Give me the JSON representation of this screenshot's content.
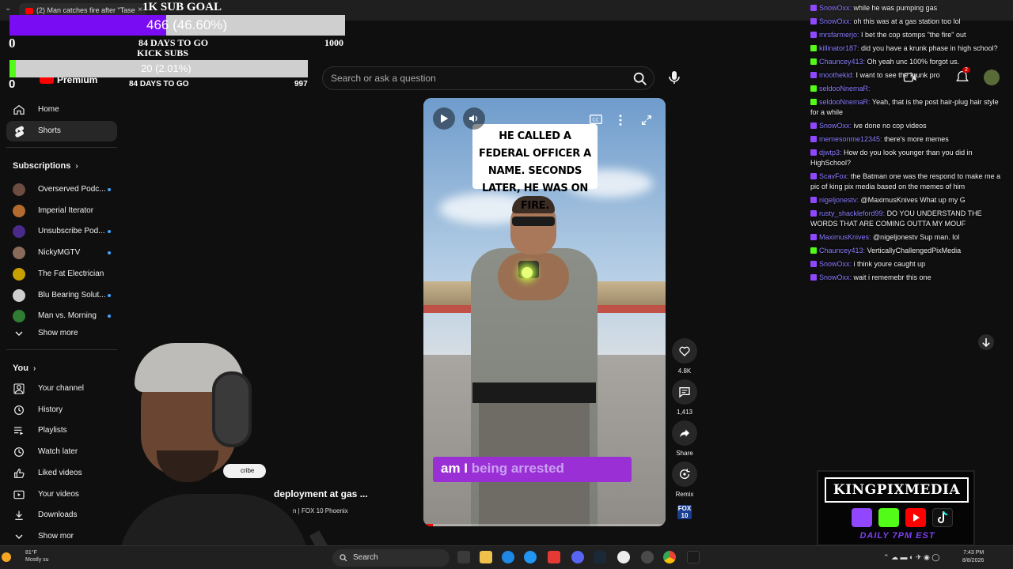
{
  "browser": {
    "tab_title": "(2) Man catches fire after \"Tase",
    "tab_close": "×"
  },
  "goal": {
    "title": "1K SUB GOAL",
    "bar_label": "466 (46.60%)",
    "progress": 0.466,
    "left_value": "0",
    "days": "84 DAYS TO GO",
    "right_value": "1000"
  },
  "kick_goal": {
    "title": "KICK SUBS",
    "bar_label": "20 (2.01%)",
    "progress": 0.0201,
    "left_value": "0",
    "days": "84 DAYS TO GO",
    "right_value": "997"
  },
  "header": {
    "logo_label": "Premium",
    "search_placeholder": "Search or ask a question",
    "notification_count": "2"
  },
  "sidebar": {
    "nav": [
      {
        "label": "Home",
        "icon": "home-icon"
      },
      {
        "label": "Shorts",
        "icon": "shorts-icon"
      }
    ],
    "subscriptions_title": "Subscriptions",
    "subscriptions": [
      {
        "label": "Overserved Podc...",
        "dot": true,
        "color": "#6d4c41"
      },
      {
        "label": "Imperial Iterator",
        "dot": false,
        "color": "#b36a2e"
      },
      {
        "label": "Unsubscribe Pod...",
        "dot": true,
        "color": "#4a2a8a"
      },
      {
        "label": "NickyMGTV",
        "dot": true,
        "color": "#8a6a5a"
      },
      {
        "label": "The Fat Electrician",
        "dot": false,
        "color": "#c8a000"
      },
      {
        "label": "Blu Bearing Solut...",
        "dot": true,
        "color": "#cfcfcf"
      },
      {
        "label": "Man vs. Morning",
        "dot": true,
        "color": "#2e7d32"
      }
    ],
    "show_more": "Show more",
    "you_title": "You",
    "you_items": [
      {
        "label": "Your channel",
        "icon": "person-icon"
      },
      {
        "label": "History",
        "icon": "history-icon"
      },
      {
        "label": "Playlists",
        "icon": "playlist-icon"
      },
      {
        "label": "Watch later",
        "icon": "clock-icon"
      },
      {
        "label": "Liked videos",
        "icon": "thumbs-up-icon"
      },
      {
        "label": "Your videos",
        "icon": "play-square-icon"
      },
      {
        "label": "Downloads",
        "icon": "download-icon"
      }
    ],
    "show_more_2": "Show mor"
  },
  "video": {
    "caption": "HE CALLED A FEDERAL OFFICER A NAME. SECONDS LATER, HE WAS ON FIRE.",
    "sub_caption_a": "am I",
    "sub_caption_b": "being arrested",
    "title": "deployment at gas ...",
    "channel": "n | FOX 10 Phoenix",
    "subscribe_label": "cribe",
    "progress": 0.04
  },
  "actions": {
    "likes": "4.8K",
    "comments": "1,413",
    "share": "Share",
    "remix": "Remix",
    "fox_logo": "FOX 10"
  },
  "chat": [
    {
      "platform": "twitch",
      "user": "SnowOxx",
      "color": "#8a7cff",
      "message": "while he was pumping gas"
    },
    {
      "platform": "twitch",
      "user": "SnowOxx",
      "color": "#8a7cff",
      "message": "oh this was at a gas station too lol"
    },
    {
      "platform": "twitch",
      "user": "mrsfarmerjo",
      "color": "#8a7cff",
      "message": "I bet the cop stomps \"the fire\" out"
    },
    {
      "platform": "kick",
      "user": "killinator187",
      "color": "#8a7cff",
      "message": "did you have a krunk phase in high school?"
    },
    {
      "platform": "kick",
      "user": "Chauncey413",
      "color": "#8a7cff",
      "message": "Oh yeah unc 100% forgot us."
    },
    {
      "platform": "twitch",
      "user": "moothekid",
      "color": "#8a7cff",
      "message": "I want to see the krunk pro"
    },
    {
      "platform": "kick",
      "user": "seldooNnemaR",
      "color": "#8a7cff",
      "message": ""
    },
    {
      "platform": "kick",
      "user": "seldooNnemaR",
      "color": "#8a7cff",
      "message": "Yeah, that is the post hair-plug hair style for a while"
    },
    {
      "platform": "twitch",
      "user": "SnowOxx",
      "color": "#8a7cff",
      "message": "ive done no cop videos"
    },
    {
      "platform": "twitch",
      "user": "memesonme12345",
      "color": "#8a7cff",
      "message": "there's more memes"
    },
    {
      "platform": "twitch",
      "user": "djwtp3",
      "color": "#8a7cff",
      "message": "How do you look younger than you did in HighSchool?"
    },
    {
      "platform": "twitch",
      "user": "ScavFox",
      "color": "#8a7cff",
      "message": "the Batman one was the respond to make me a pic of king pix media based on the memes of him"
    },
    {
      "platform": "twitch",
      "user": "nigeljonestv",
      "color": "#8a7cff",
      "message": "@MaximusKnives What up my G"
    },
    {
      "platform": "twitch",
      "user": "rusty_shackleford99",
      "color": "#8a7cff",
      "message": "DO YOU UNDERSTAND THE WORDS THAT ARE COMING OUTTA MY MOUF"
    },
    {
      "platform": "twitch",
      "user": "MaximusKnives",
      "color": "#8a7cff",
      "message": "@nigeljonestv Sup man. lol"
    },
    {
      "platform": "kick",
      "user": "Chauncey413",
      "color": "#8a7cff",
      "message": "VerticallyChallengedPixMedia"
    },
    {
      "platform": "twitch",
      "user": "SnowOxx",
      "color": "#8a7cff",
      "message": "i think youre caught up"
    },
    {
      "platform": "twitch",
      "user": "SnowOxx",
      "color": "#8a7cff",
      "message": "wait i rememebr this one"
    }
  ],
  "brand": {
    "name": "KINGPIXMEDIA",
    "tagline": "DAILY 7PM EST"
  },
  "taskbar": {
    "weather_temp": "81°F",
    "weather_desc": "Mostly su",
    "search_label": "Search",
    "time": "7:43 PM",
    "date": "8/8/2026"
  }
}
